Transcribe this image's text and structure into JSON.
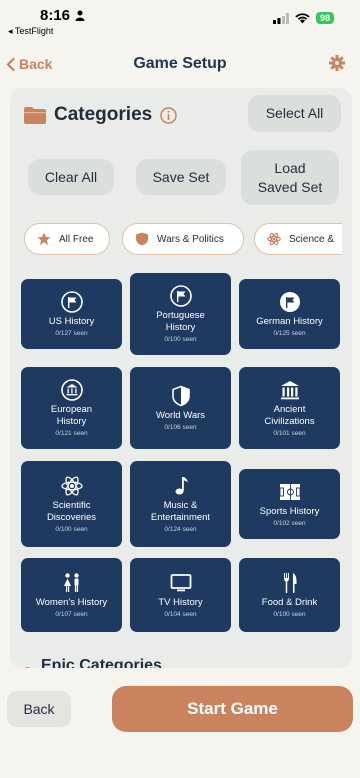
{
  "status_bar": {
    "time": "8:16",
    "back_app": "◂ TestFlight",
    "battery": "98"
  },
  "nav": {
    "back_label": "Back",
    "title": "Game Setup",
    "settings_icon": "gear-icon"
  },
  "categories": {
    "title": "Categories",
    "select_all": "Select All",
    "clear_all": "Clear All",
    "save_set": "Save Set",
    "load_saved_set": "Load\nSaved Set"
  },
  "chips": [
    {
      "label": "All Free",
      "icon": "star-icon"
    },
    {
      "label": "Wars & Politics",
      "icon": "shield-icon"
    },
    {
      "label": "Science &",
      "icon": "atom-icon"
    }
  ],
  "tiles": [
    {
      "name": "US History",
      "seen": "0/127 seen",
      "icon": "flag-icon"
    },
    {
      "name": "Portuguese History",
      "seen": "0/100 seen",
      "icon": "flag-icon"
    },
    {
      "name": "German History",
      "seen": "0/125 seen",
      "icon": "flag-icon"
    },
    {
      "name": "European History",
      "seen": "0/121 seen",
      "icon": "bank-icon"
    },
    {
      "name": "World Wars",
      "seen": "0/106 seen",
      "icon": "shield-icon"
    },
    {
      "name": "Ancient Civilizations",
      "seen": "0/101 seen",
      "icon": "columns-icon"
    },
    {
      "name": "Scientific Discoveries",
      "seen": "0/100 seen",
      "icon": "atom-icon"
    },
    {
      "name": "Music & Entertainment",
      "seen": "0/124 seen",
      "icon": "music-note-icon"
    },
    {
      "name": "Sports History",
      "seen": "0/102 seen",
      "icon": "soccer-field-icon"
    },
    {
      "name": "Women's History",
      "seen": "0/107 seen",
      "icon": "women-icon"
    },
    {
      "name": "TV History",
      "seen": "0/104 seen",
      "icon": "tv-icon"
    },
    {
      "name": "Food & Drink",
      "seen": "0/100 seen",
      "icon": "fork-knife-icon"
    }
  ],
  "epic": {
    "title": "Epic Categories"
  },
  "bottom": {
    "back_label": "Back",
    "start_label": "Start Game"
  },
  "colors": {
    "accent": "#c9845f",
    "tile": "#1f3a60",
    "panel": "#e9ece9"
  }
}
